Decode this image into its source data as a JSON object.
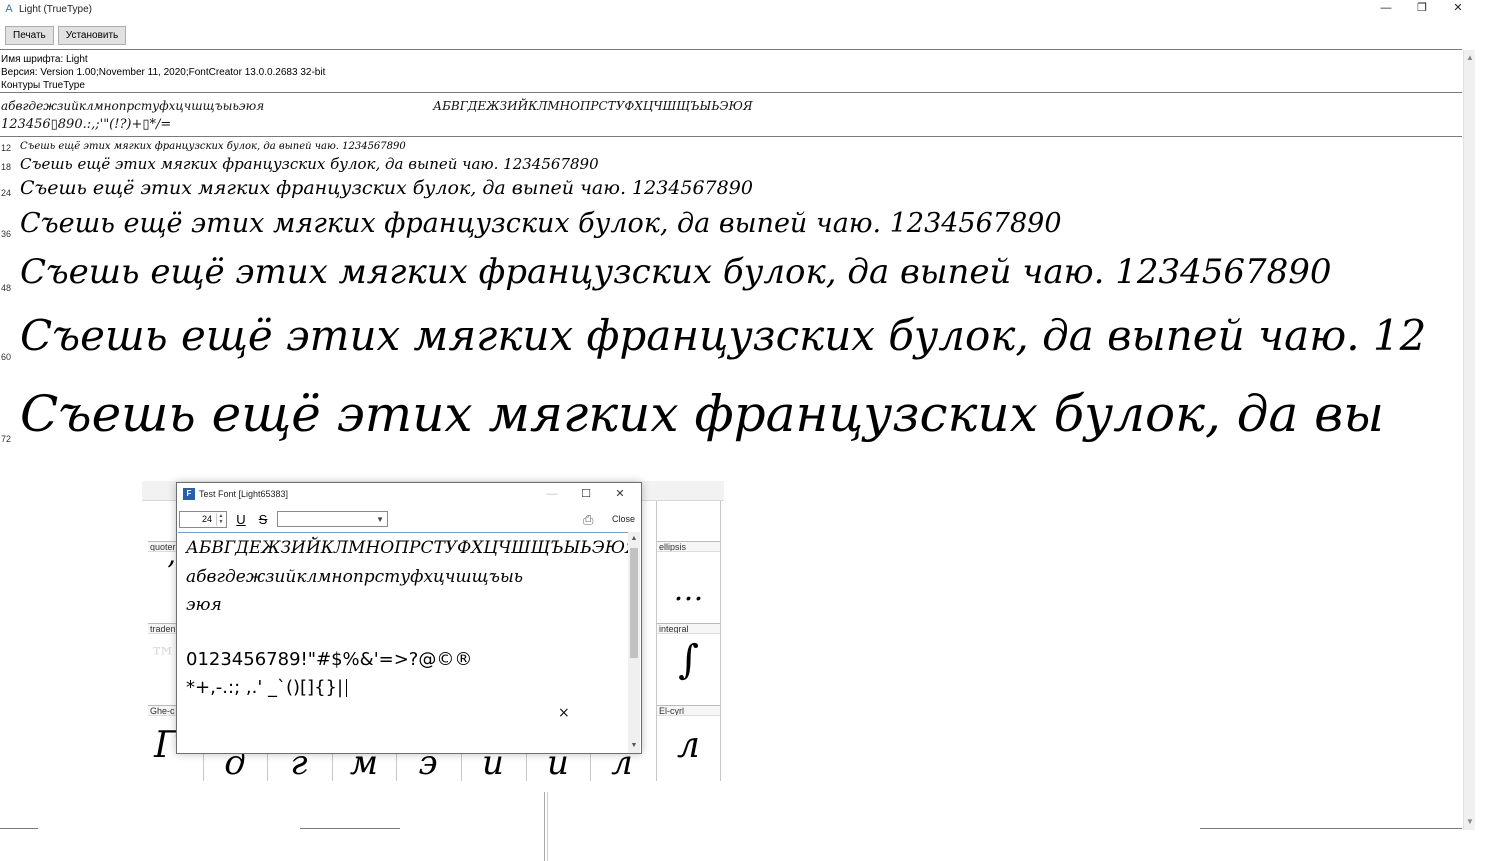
{
  "window": {
    "title": "Light (TrueType)",
    "controls": {
      "minimize": "—",
      "maximize": "❐",
      "close": "✕"
    },
    "icon": "font-file-icon"
  },
  "toolbar": {
    "print_label": "Печать",
    "install_label": "Установить"
  },
  "font_info": {
    "name_line": "Имя шрифта: Light",
    "version_line": "Версия: Version 1.00;November 11, 2020;FontCreator 13.0.0.2683 32-bit",
    "outline_line": "Контуры TrueType"
  },
  "charset": {
    "lowercase": "абвгдежзийклмнопрстуфхцчшщъыьэюя",
    "uppercase": "АБВГДЕЖЗИЙКЛМНОПРСТУФХЦЧШЩЪЫЬЭЮЯ",
    "digits": "123456▯890.:,;'\"(!?)+▯*/="
  },
  "samples": [
    {
      "size": "12",
      "text": "Съешь ещё этих мягких французских булок, да выпей чаю. 1234567890"
    },
    {
      "size": "18",
      "text": "Съешь ещё этих мягких французских булок, да выпей чаю. 1234567890"
    },
    {
      "size": "24",
      "text": "Съешь ещё этих мягких французских булок, да выпей чаю. 1234567890"
    },
    {
      "size": "36",
      "text": "Съешь ещё этих мягких французских булок, да выпей чаю. 1234567890"
    },
    {
      "size": "48",
      "text": "Съешь ещё этих мягких французских булок, да выпей чаю. 1234567890"
    },
    {
      "size": "60",
      "text": "Съешь ещё этих мягких французских булок, да выпей чаю. 12"
    },
    {
      "size": "72",
      "text": "Съешь ещё этих мягких французских булок, да вы"
    }
  ],
  "glyph_grid": {
    "labels": {
      "quote": "quoter",
      "ellipsis": "ellipsis",
      "trade": "traden",
      "integral": "integral",
      "ghe": "Ghe-c",
      "el": "El-cyrl"
    },
    "glyphs": {
      "quote": "’",
      "ellipsis": "…",
      "trade": "™",
      "integral": "∫",
      "ghe": "Г",
      "el": "л",
      "row3": [
        "д",
        "г",
        "м",
        "э",
        "и",
        "и",
        "л"
      ]
    }
  },
  "test_dialog": {
    "title": "Test Font [Light65383]",
    "size_value": "24",
    "underline_label": "U",
    "strike_label": "S",
    "select_value": "",
    "close_label": "Close",
    "lines": [
      "АБВГДЕЖЗИЙКЛМНОПРСТУФХЦЧШЩЪЫЬЭЮЯ",
      "абвгдежзийклмнопрстуфхцчшщъыь",
      "эюя",
      "0123456789!\"#$%&'=>?@©®",
      "*+,-.:;  ,.' _`()[]{}|"
    ],
    "x_mark": "×"
  }
}
